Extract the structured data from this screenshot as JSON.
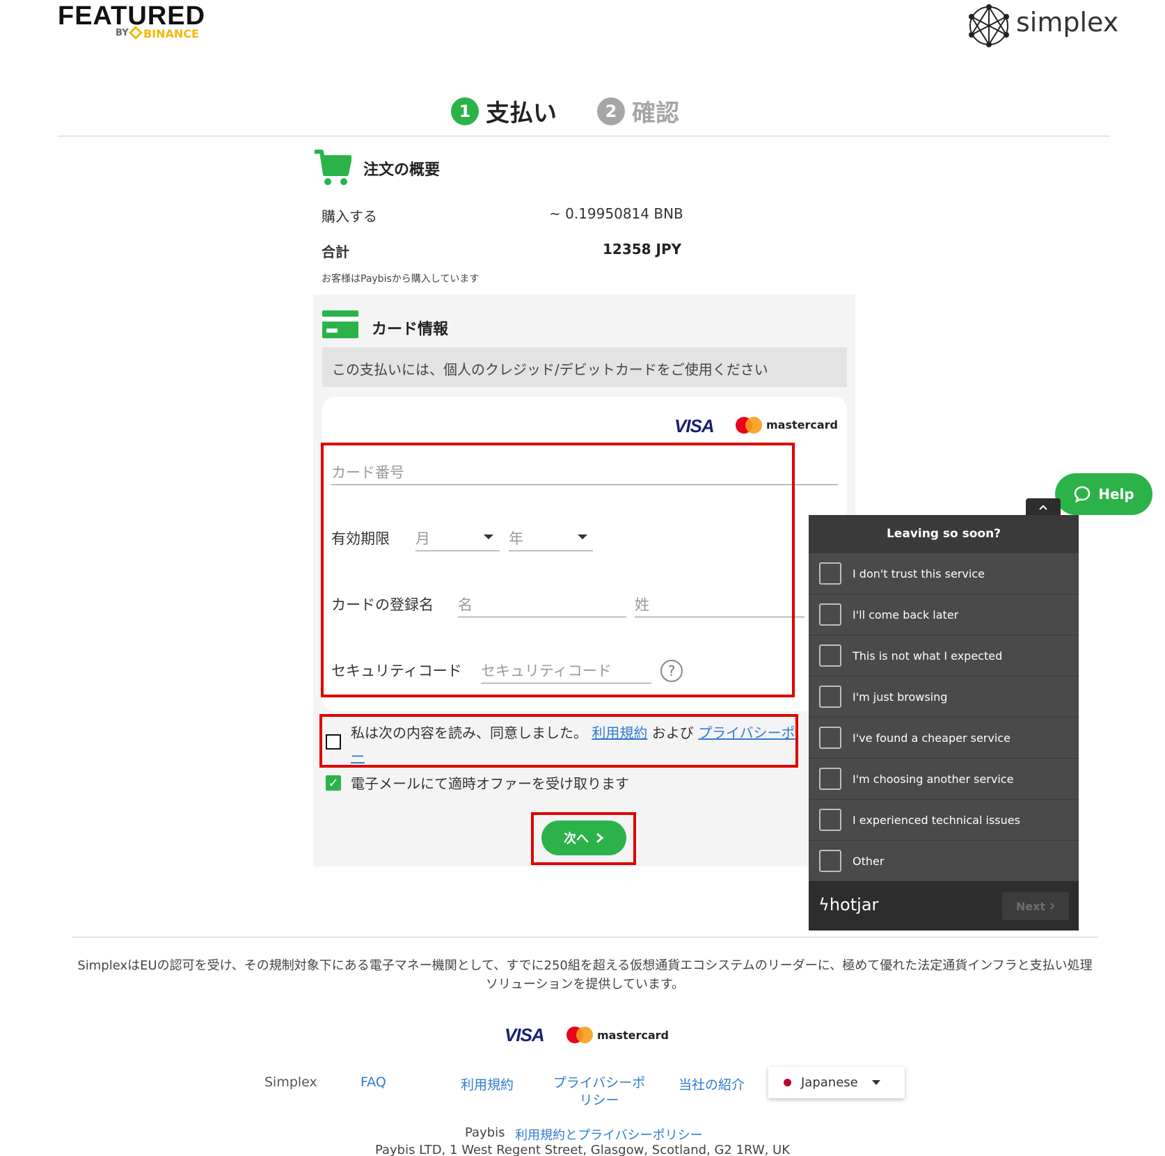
{
  "header": {
    "featured": "FEATURED",
    "by": "BY",
    "binance": "BINANCE",
    "simplex": "simplex"
  },
  "steps": [
    {
      "num": "1",
      "label": "支払い",
      "active": true
    },
    {
      "num": "2",
      "label": "確認",
      "active": false
    }
  ],
  "order": {
    "title": "注文の概要",
    "buy_label": "購入する",
    "buy_value": "~ 0.19950814 BNB",
    "total_label": "合計",
    "total_value": "12358 JPY",
    "note": "お客様はPaybisから購入しています"
  },
  "card": {
    "title": "カード情報",
    "notice": "この支払いには、個人のクレジッド/デビットカードをご使用ください",
    "visa": "VISA",
    "mastercard": "mastercard",
    "card_number_placeholder": "カード番号",
    "expiry_label": "有効期限",
    "month_placeholder": "月",
    "year_placeholder": "年",
    "name_label": "カードの登録名",
    "first_placeholder": "名",
    "last_placeholder": "姓",
    "cvv_label": "セキュリティコード",
    "cvv_placeholder": "セキュリティコード",
    "cvv_help": "?"
  },
  "agreement": {
    "prefix": "私は次の内容を読み、同意しました。",
    "terms_link": "利用規約",
    "and": "および",
    "privacy_link": "プライバシーポ",
    "privacy_tail": "ー",
    "offers": "電子メールにて適時オファーを受け取ります",
    "offers_checked": true,
    "next_button": "次へ"
  },
  "hotjar": {
    "help": "Help",
    "title": "Leaving so soon?",
    "options": [
      "I don't trust this service",
      "I'll come back later",
      "This is not what I expected",
      "I'm just browsing",
      "I've found a cheaper service",
      "I'm choosing another service",
      "I experienced technical issues",
      "Other"
    ],
    "brand": "hotjar",
    "next": "Next"
  },
  "footer": {
    "description": "SimplexはEUの認可を受け、その規制対象下にある電子マネー機関として、すでに250組を超える仮想通貨エコシステムのリーダーに、極めて優れた法定通貨インフラと支払い処理ソリューションを提供しています。",
    "visa": "VISA",
    "mastercard": "mastercard",
    "links": {
      "simplex": "Simplex",
      "faq": "FAQ",
      "terms": "利用規約",
      "privacy": "プライバシーポリシー",
      "about": "当社の紹介"
    },
    "language": "Japanese",
    "paybis": "Paybis",
    "paybis_link": "利用規約とプライバシーポリシー",
    "address": "Paybis LTD, 1 West Regent Street, Glasgow, Scotland, G2 1RW, UK"
  },
  "colors": {
    "accent_green": "#2bb34a",
    "highlight_red": "#e00000",
    "link_blue": "#2f7bd1",
    "hotjar_bg": "#4a4a4a"
  }
}
